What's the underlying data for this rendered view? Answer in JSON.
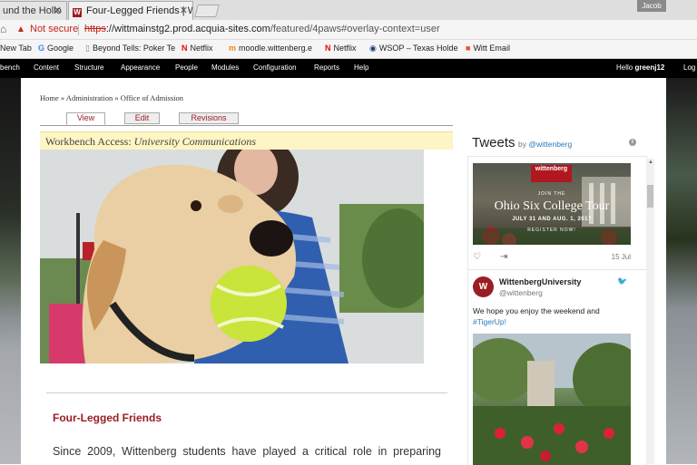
{
  "browser": {
    "tabs": [
      {
        "label": "und the Hollo",
        "active": false
      },
      {
        "label": "Four-Legged Friends | W",
        "active": true
      }
    ],
    "profile_name": "Jacob",
    "security_label": "Not secure",
    "url_scheme": "https",
    "url_host": "://wittmainstg2.prod.acquia-sites.com",
    "url_path": "/featured/4paws#overlay-context=user",
    "bookmarks": [
      {
        "label": "New Tab",
        "icon": "page-icon"
      },
      {
        "label": "Google",
        "icon": "google-icon"
      },
      {
        "label": "Beyond Tells: Poker Te",
        "icon": "page-icon"
      },
      {
        "label": "Netflix",
        "icon": "netflix-icon"
      },
      {
        "label": "moodle.wittenberg.e",
        "icon": "moodle-icon"
      },
      {
        "label": "Netflix",
        "icon": "netflix-icon"
      },
      {
        "label": "WSOP – Texas Holde",
        "icon": "wsop-icon"
      },
      {
        "label": "Witt Email",
        "icon": "windows-icon"
      }
    ]
  },
  "admin_bar": {
    "items": [
      "bench",
      "Content",
      "Structure",
      "Appearance",
      "People",
      "Modules",
      "Configuration",
      "Reports",
      "Help"
    ],
    "hello_label": "Hello",
    "username": "greenj12",
    "logout": "Log"
  },
  "page": {
    "breadcrumb": "Home » Administration » Office of Admission",
    "tabs": [
      "View",
      "Edit",
      "Revisions"
    ],
    "active_tab": "View",
    "workbench_label": "Workbench Access:",
    "workbench_value": "University Communications",
    "article_title": "Four-Legged Friends",
    "article_body": "Since 2009, Wittenberg students have played a critical role in preparing"
  },
  "twitter": {
    "title": "Tweets",
    "by": "by",
    "handle": "@wittenberg",
    "promo": {
      "logo": "wittenberg",
      "join": "JOIN THE",
      "title": "Ohio Six College Tour",
      "dates": "JULY 31 AND AUG. 1, 2017",
      "register": "REGISTER NOW!"
    },
    "tweet1_date": "15 Jul",
    "tweet2": {
      "name": "WittenbergUniversity",
      "handle": "@wittenberg",
      "text": "We hope you enjoy the weekend and",
      "hashtag": "#TigerUp!"
    }
  },
  "colors": {
    "accent": "#9a1d23",
    "workbench_bg": "#fdf5c3",
    "admin_bar": "#000000",
    "twitter_link": "#2b7bb9"
  }
}
